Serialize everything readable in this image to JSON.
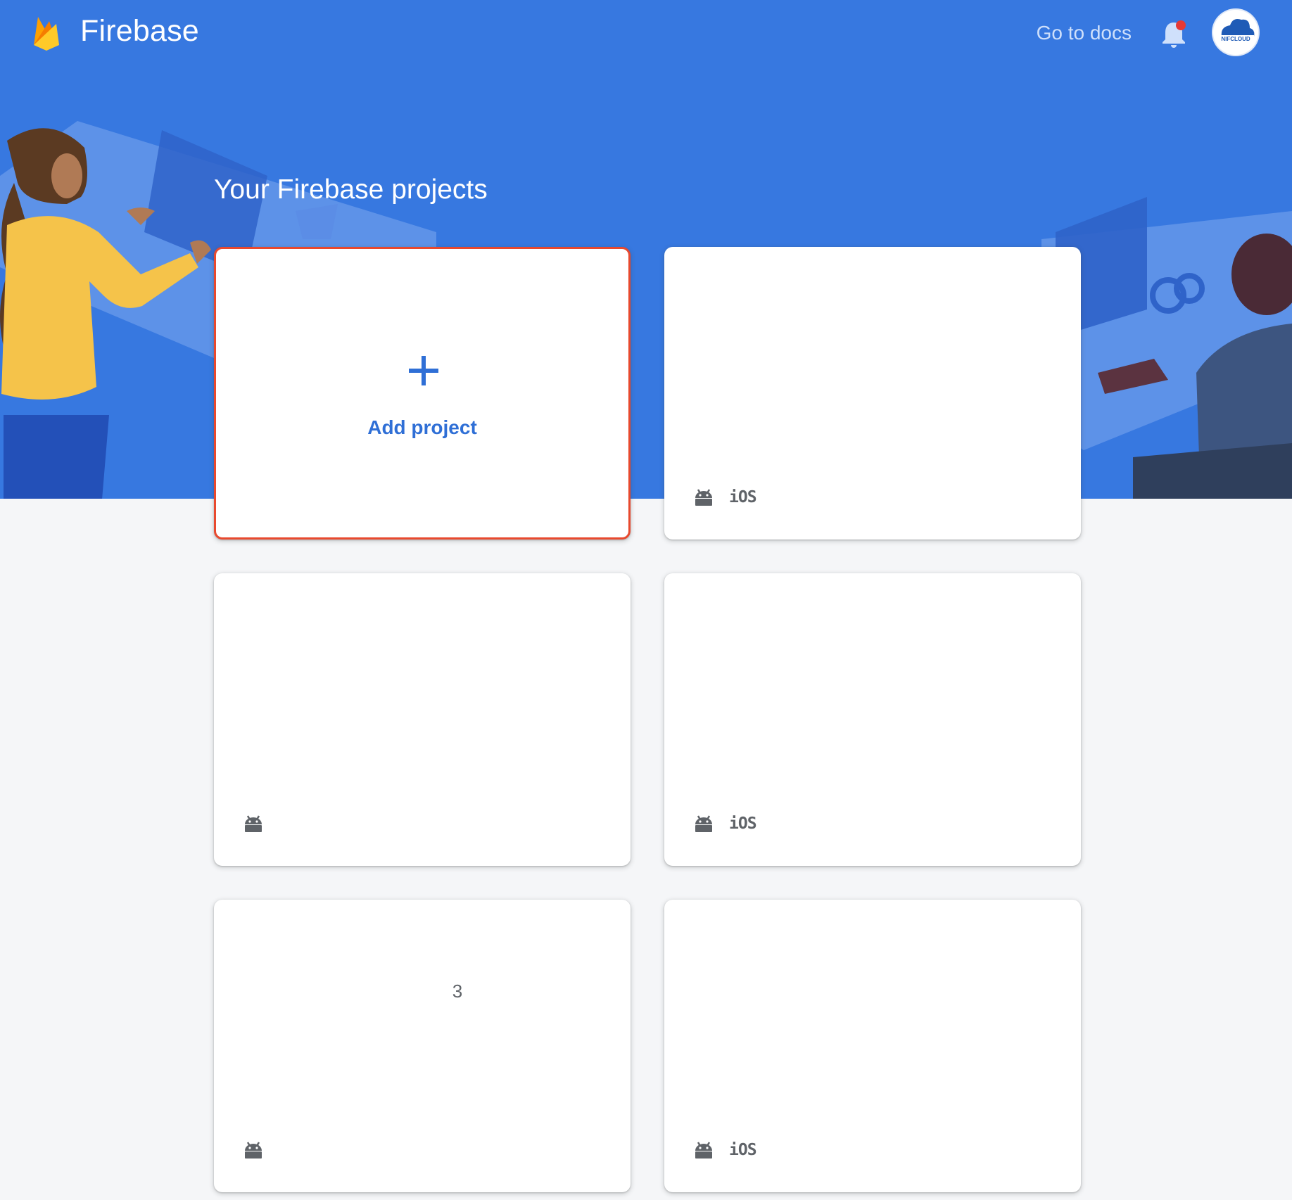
{
  "header": {
    "brand": "Firebase",
    "docs_link": "Go to docs"
  },
  "page": {
    "title": "Your Firebase projects"
  },
  "add_card": {
    "label": "Add project"
  },
  "projects": [
    {
      "platforms": [
        "android",
        "ios"
      ],
      "ios_label": "iOS"
    },
    {
      "platforms": [
        "android"
      ]
    },
    {
      "platforms": [
        "android",
        "ios"
      ],
      "ios_label": "iOS"
    },
    {
      "platforms": [
        "android"
      ],
      "count": "3"
    },
    {
      "platforms": [
        "android",
        "ios"
      ],
      "ios_label": "iOS"
    }
  ],
  "colors": {
    "hero_bg": "#3778e0",
    "page_bg": "#f5f6f8",
    "accent": "#2f6fd6",
    "add_border": "#e8492e"
  }
}
